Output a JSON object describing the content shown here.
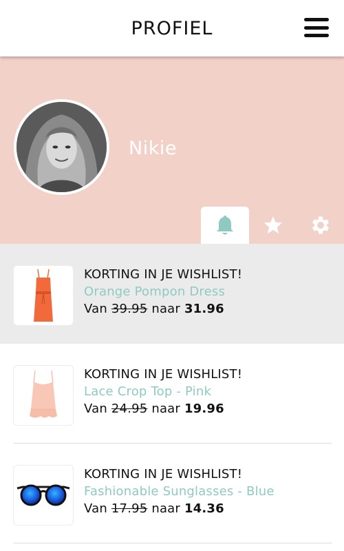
{
  "header": {
    "title": "PROFIEL",
    "menu_icon": "hamburger-menu-icon"
  },
  "profile": {
    "name": "Nikie",
    "background_color": "#f2d1c9",
    "tabs": [
      {
        "icon": "bell-icon",
        "active": true
      },
      {
        "icon": "star-icon",
        "active": false
      },
      {
        "icon": "gear-icon",
        "active": false
      }
    ]
  },
  "notifications": [
    {
      "headline": "KORTING IN JE WISHLIST!",
      "product": "Orange Pompon Dress",
      "van": "Van",
      "old_price": "39.95",
      "naar": "naar",
      "new_price": "31.96",
      "thumbnail_icon": "orange-dress-icon",
      "highlighted": true
    },
    {
      "headline": "KORTING IN JE WISHLIST!",
      "product": "Lace Crop Top - Pink",
      "van": "Van",
      "old_price": "24.95",
      "naar": "naar",
      "new_price": "19.96",
      "thumbnail_icon": "pink-top-icon",
      "highlighted": false
    },
    {
      "headline": "KORTING IN JE WISHLIST!",
      "product": "Fashionable Sunglasses - Blue",
      "van": "Van",
      "old_price": "17.95",
      "naar": "naar",
      "new_price": "14.36",
      "thumbnail_icon": "sunglasses-icon",
      "highlighted": false
    }
  ],
  "colors": {
    "accent_teal": "#8fcac2",
    "highlight_row": "#eaebea",
    "profile_bg": "#f2d1c9"
  }
}
